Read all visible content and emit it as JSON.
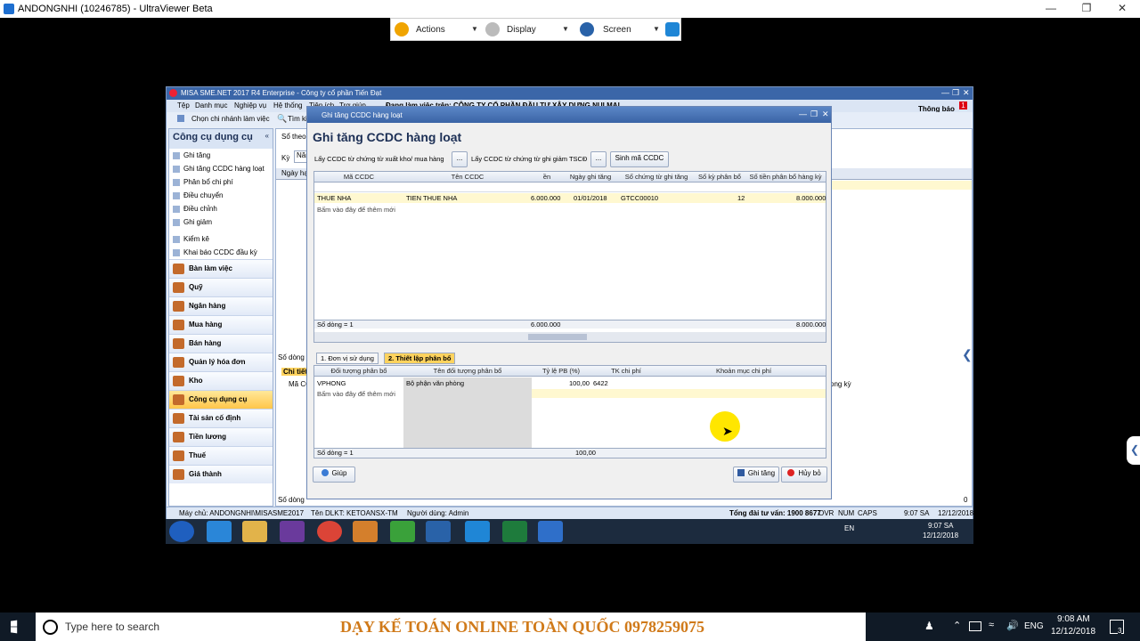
{
  "viewer": {
    "title": "ANDONGNHI (10246785) - UltraViewer Beta",
    "toolbar": {
      "actions": "Actions",
      "display": "Display",
      "screen": "Screen"
    }
  },
  "misa": {
    "title": "MISA SME.NET 2017 R4 Enterprise - Công ty cổ phần Tiến Đạt",
    "menu": [
      "Tệp",
      "Danh mục",
      "Nghiệp vụ",
      "Hệ thống",
      "Tiện ích",
      "Trợ giúp"
    ],
    "menu_banner": "Đang làm việc trên: CÔNG TY CỔ PHẦN ĐẦU TƯ XÂY DỰNG NUI MAI",
    "toolbar": {
      "branch": "Chọn chi nhánh làm việc",
      "search": "Tìm kiếm"
    },
    "notify": "Thông báo",
    "notify_count": "1",
    "left": {
      "title": "Công cụ dụng cụ",
      "subitems": [
        "Ghi tăng",
        "Ghi tăng CCDC hàng loạt",
        "Phân bổ chi phí",
        "Điều chuyển",
        "Điều chỉnh",
        "Ghi giảm"
      ],
      "subitems2": [
        "Kiểm kê",
        "Khai báo CCDC đầu kỳ"
      ],
      "modules": [
        "Bàn làm việc",
        "Quỹ",
        "Ngân hàng",
        "Mua hàng",
        "Bán hàng",
        "Quản lý hóa đơn",
        "Kho",
        "Công cụ dụng cụ",
        "Tài sản cố định",
        "Tiền lương",
        "Thuế",
        "Giá thành"
      ],
      "selected": "Công cụ dụng cụ"
    },
    "bg": {
      "so_theo": "Sổ theo c",
      "ky": "Kỳ",
      "nam": "Năm",
      "ngay_hach": "Ngày hạc",
      "so_dong": "Số dòng",
      "chi_tiet": "Chi tiết",
      "ma_cc": "Mã CC",
      "ong_ky": "ong kỳ",
      "zero": "0"
    },
    "status": {
      "server": "Máy chủ: ANDONGNHI\\MISASME2017",
      "db": "Tên DLKT: KETOANSX-TM",
      "user": "Người dùng: Admin",
      "hotline": "Tổng đài tư vấn: 1900 8677",
      "ovr": "OVR",
      "num": "NUM",
      "caps": "CAPS",
      "time": "9:07 SA",
      "date": "12/12/2018"
    }
  },
  "dialog": {
    "window_title": "Ghi tăng CCDC hàng loạt",
    "heading": "Ghi tăng CCDC hàng loạt",
    "link1": "Lấy CCDC từ chứng từ xuất kho/ mua hàng",
    "link2": "Lấy CCDC từ chứng từ ghi giảm TSCĐ",
    "browse": "...",
    "gen_button": "Sinh mã CCDC",
    "grid1": {
      "headers": [
        "Mã CCDC",
        "Tên CCDC",
        "ền",
        "Ngày ghi tăng",
        "Số chứng từ ghi tăng",
        "Số kỳ phân bổ",
        "Số tiền phân bổ hàng kỳ"
      ],
      "row": [
        "THUE NHA",
        "TIEN THUE NHA",
        "6.000.000",
        "01/01/2018",
        "GTCC00010",
        "12",
        "8.000.000"
      ],
      "add_hint": "Bấm vào đây để thêm mới",
      "footer_count": "Số dòng = 1",
      "footer_total": "6.000.000",
      "footer_total2": "8.000.000"
    },
    "tabs": [
      "1. Đơn vị sử dụng",
      "2. Thiết lập phân bổ"
    ],
    "grid2": {
      "headers": [
        "Đối tượng phân bổ",
        "Tên đối tượng phân bổ",
        "Tỷ lệ PB (%)",
        "TK chi phí",
        "Khoản mục chi phí"
      ],
      "row": [
        "VPHONG",
        "Bộ phận văn phòng",
        "100,00",
        "6422",
        ""
      ],
      "add_hint": "Bấm vào đây để thêm mới",
      "footer_count": "Số dòng = 1",
      "footer_total": "100,00"
    },
    "help": "Giúp",
    "save": "Ghi tăng",
    "cancel": "Hủy bỏ"
  },
  "inner_tray": {
    "lang": "EN",
    "time": "9:07 SA",
    "date": "12/12/2018"
  },
  "windows": {
    "search_placeholder": "Type here to search",
    "banner": "DẠY KẾ TOÁN ONLINE TOÀN QUỐC 0978259075",
    "lang": "ENG",
    "time": "9:08 AM",
    "date": "12/12/2018",
    "notif_count": "3"
  },
  "colors": {
    "accent": "#3a64a5",
    "selected_module": "#ffc64a",
    "cursor_highlight": "#ffe600"
  }
}
